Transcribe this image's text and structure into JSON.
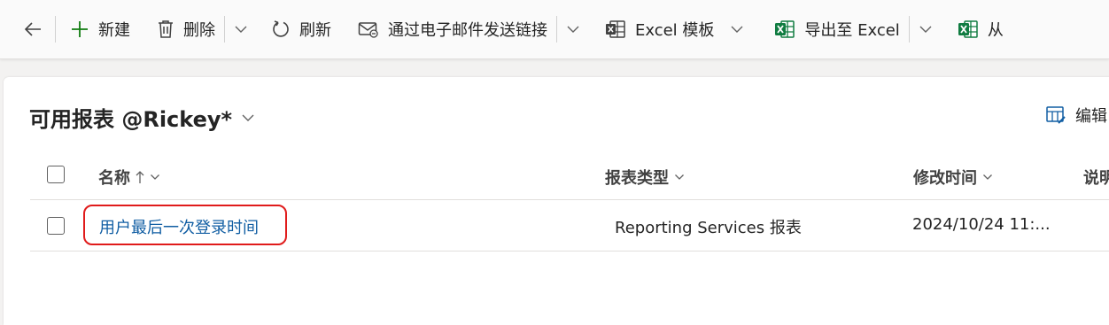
{
  "toolbar": {
    "new_label": "新建",
    "delete_label": "删除",
    "refresh_label": "刷新",
    "email_link_label": "通过电子邮件发送链接",
    "excel_template_label": "Excel 模板",
    "export_excel_label": "导出至 Excel",
    "import_label": "从"
  },
  "view": {
    "title": "可用报表 @Rickey*",
    "edit_columns_label": "编辑"
  },
  "grid": {
    "columns": [
      {
        "label": "名称",
        "sort": "ascending"
      },
      {
        "label": "报表类型"
      },
      {
        "label": "修改时间"
      },
      {
        "label": "说明"
      }
    ],
    "rows": [
      {
        "name": "用户最后一次登录时间",
        "report_type": "Reporting Services 报表",
        "modified": "2024/10/24 11:..."
      }
    ]
  },
  "colors": {
    "accent_green": "#107c10",
    "excel_green": "#107c41",
    "link_blue": "#115ea3",
    "highlight_red": "#e01b1b"
  }
}
